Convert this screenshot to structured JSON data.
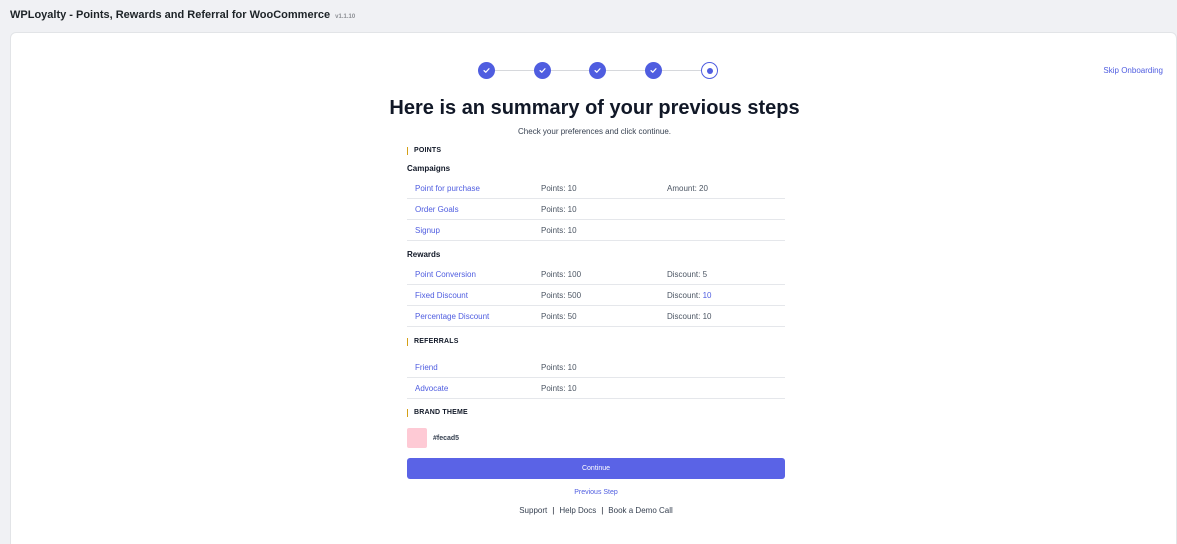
{
  "app": {
    "title": "WPLoyalty - Points, Rewards and Referral for WooCommerce",
    "version": "v1.1.10"
  },
  "skip_label": "Skip Onboarding",
  "stepper": {
    "completed_steps": 4,
    "current_step": 5,
    "total_steps": 5
  },
  "heading": "Here is an summary of your previous steps",
  "subheading": "Check your preferences and click continue.",
  "points": {
    "section_title": "POINTS",
    "campaigns": {
      "title": "Campaigns",
      "rows": [
        {
          "name": "Point for purchase",
          "points": "Points: 10",
          "extra": "Amount: 20"
        },
        {
          "name": "Order Goals",
          "points": "Points: 10",
          "extra": ""
        },
        {
          "name": "Signup",
          "points": "Points: 10",
          "extra": ""
        }
      ]
    },
    "rewards": {
      "title": "Rewards",
      "rows": [
        {
          "name": "Point Conversion",
          "points": "Points: 100",
          "extra_label": "Discount:",
          "extra_value": "5"
        },
        {
          "name": "Fixed Discount",
          "points": "Points: 500",
          "extra_label": "Discount:",
          "extra_value": "10"
        },
        {
          "name": "Percentage Discount",
          "points": "Points: 50",
          "extra_label": "Discount:",
          "extra_value": "10"
        }
      ]
    }
  },
  "referrals": {
    "section_title": "REFERRALS",
    "rows": [
      {
        "name": "Friend",
        "points": "Points: 10"
      },
      {
        "name": "Advocate",
        "points": "Points: 10"
      }
    ]
  },
  "brand_theme": {
    "section_title": "BRAND THEME",
    "color": "#fecad5",
    "color_label": "#fecad5"
  },
  "continue_label": "Continue",
  "previous_label": "Previous Step",
  "footer": {
    "support": "Support",
    "help_docs": "Help Docs",
    "demo": "Book a Demo Call",
    "separator": "|"
  },
  "colors": {
    "accent": "#4f5de0",
    "button": "#5a63e6",
    "section_marker": "#d4a017"
  }
}
